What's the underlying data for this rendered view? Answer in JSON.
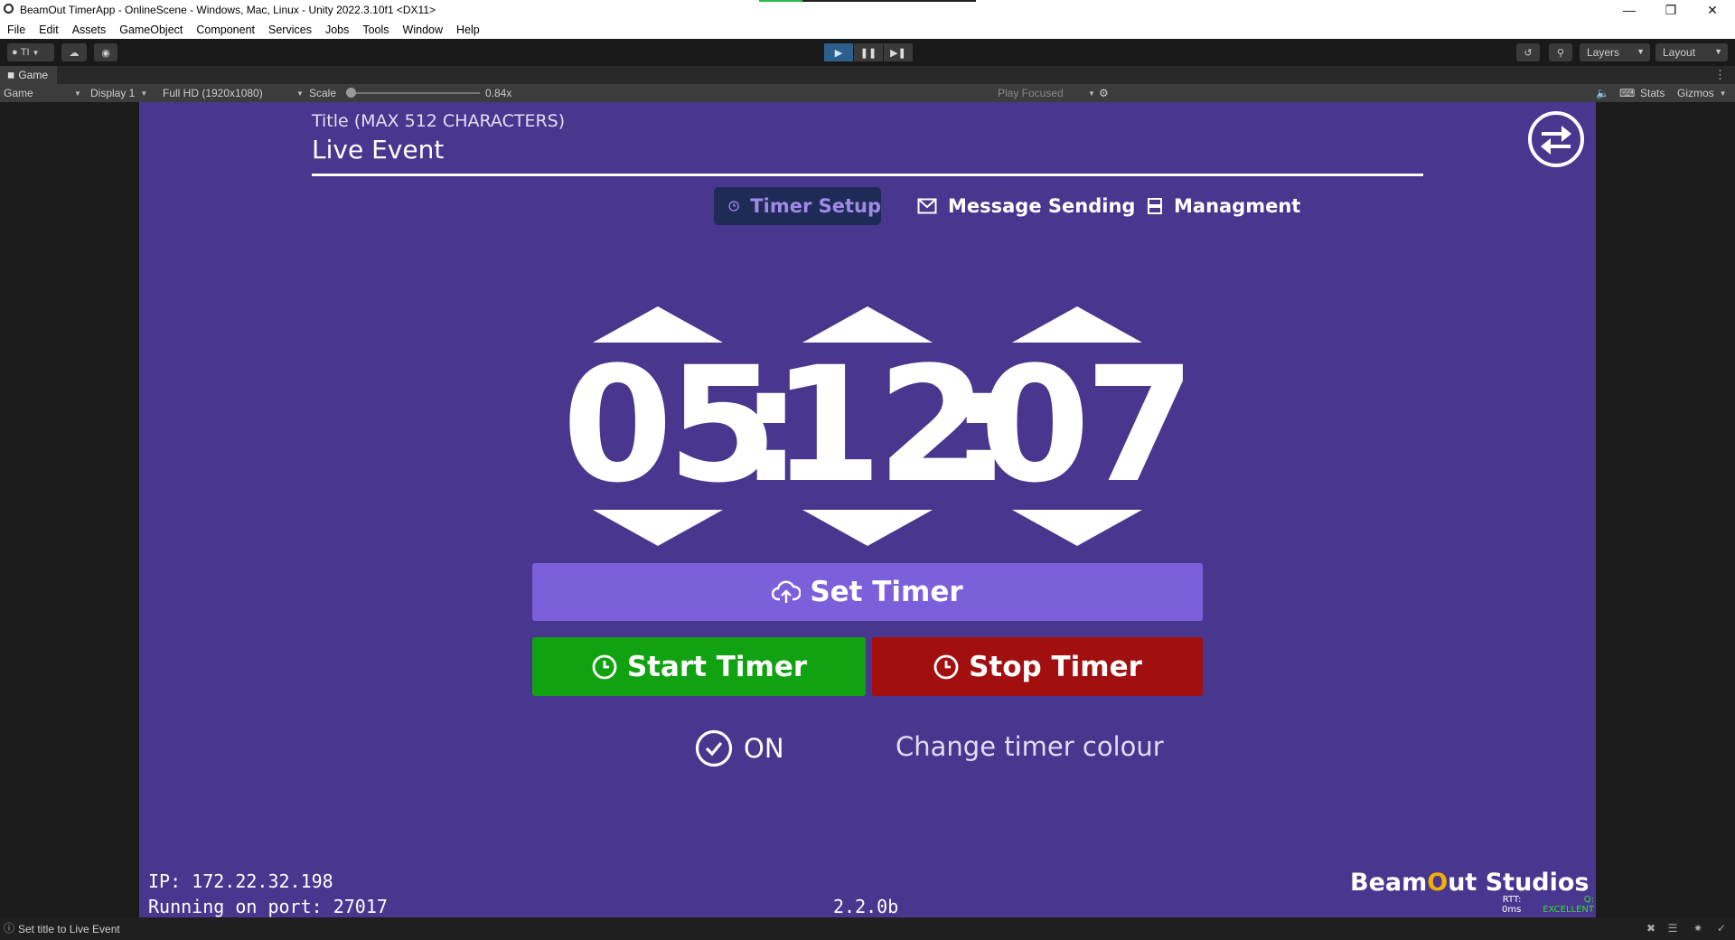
{
  "window": {
    "title": "BeamOut TimerApp - OnlineScene - Windows, Mac, Linux - Unity 2022.3.10f1 <DX11>",
    "progress": 0.2
  },
  "menu": [
    "File",
    "Edit",
    "Assets",
    "GameObject",
    "Component",
    "Services",
    "Jobs",
    "Tools",
    "Window",
    "Help"
  ],
  "toolbar": {
    "account_label": "TI",
    "layers_label": "Layers",
    "layout_label": "Layout"
  },
  "game_tab": {
    "label": "Game"
  },
  "game_bar": {
    "view_mode": "Game",
    "display": "Display 1",
    "resolution": "Full HD (1920x1080)",
    "scale_label": "Scale",
    "scale_value": "0.84x",
    "play_mode": "Play Focused",
    "stats_label": "Stats",
    "gizmos_label": "Gizmos"
  },
  "app": {
    "title_label": "Title (MAX 512 CHARACTERS)",
    "title_value": "Live Event",
    "tabs": [
      {
        "label": "Timer Setup",
        "icon": "clock-icon",
        "active": true
      },
      {
        "label": "Message Sending",
        "icon": "envelope-icon",
        "active": false
      },
      {
        "label": "Managment",
        "icon": "server-icon",
        "active": false
      }
    ],
    "timer": {
      "hours": "05",
      "minutes": "12",
      "seconds": "07",
      "separator": ":"
    },
    "set_timer_label": "Set Timer",
    "start_timer_label": "Start Timer",
    "stop_timer_label": "Stop Timer",
    "toggle_label": "ON",
    "change_colour_label": "Change timer colour",
    "ip": "IP: 172.22.32.198",
    "port": "Running on port: 27017",
    "version": "2.2.0b",
    "brand_part1": "Beam",
    "brand_o": "O",
    "brand_part2": "ut Studios",
    "rtt_label": "RTT:",
    "rtt_value": "0ms",
    "quality_label": "Q:",
    "quality_value": "EXCELLENT",
    "colors": {
      "background": "#49368e",
      "set": "#7b5fdb",
      "start": "#11a211",
      "stop": "#a20f0f",
      "active_tab": "#1f2b57"
    }
  },
  "status": {
    "message": "Set title to Live Event"
  }
}
